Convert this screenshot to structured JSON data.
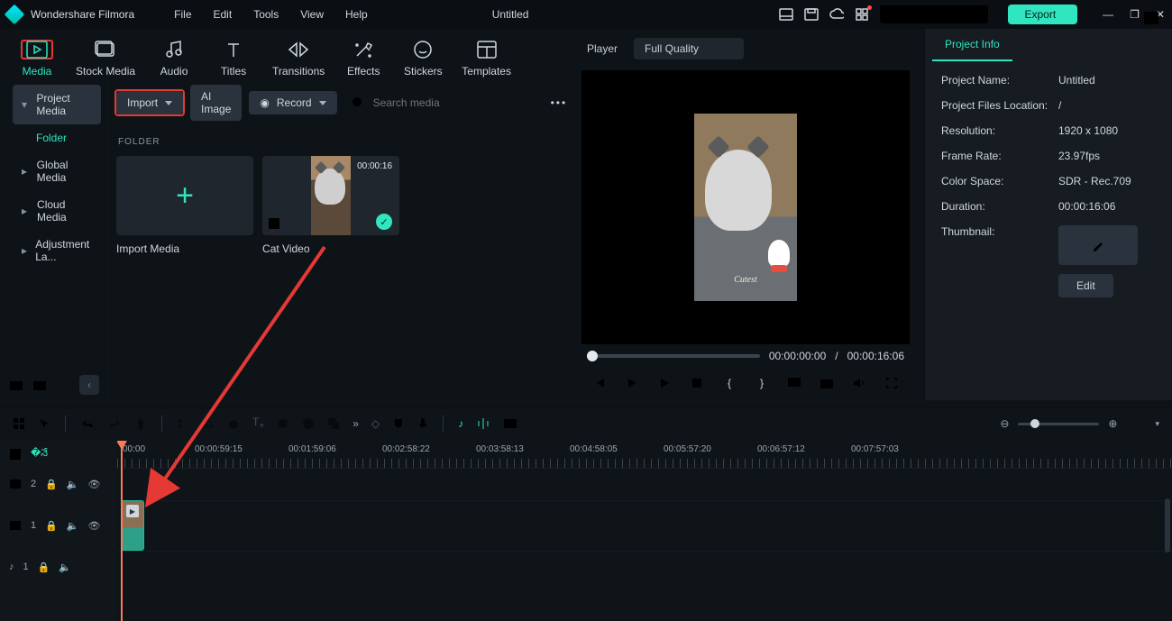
{
  "app": {
    "name": "Wondershare Filmora",
    "doc_title": "Untitled",
    "export": "Export"
  },
  "menu": [
    "File",
    "Edit",
    "Tools",
    "View",
    "Help"
  ],
  "tools": [
    {
      "id": "media",
      "label": "Media"
    },
    {
      "id": "stock-media",
      "label": "Stock Media"
    },
    {
      "id": "audio",
      "label": "Audio"
    },
    {
      "id": "titles",
      "label": "Titles"
    },
    {
      "id": "transitions",
      "label": "Transitions"
    },
    {
      "id": "effects",
      "label": "Effects"
    },
    {
      "id": "stickers",
      "label": "Stickers"
    },
    {
      "id": "templates",
      "label": "Templates"
    }
  ],
  "library": {
    "heading": "Project Media",
    "folder": "Folder",
    "items": [
      "Global Media",
      "Cloud Media",
      "Adjustment La..."
    ]
  },
  "browser": {
    "import": "Import",
    "ai": "AI Image",
    "record": "Record",
    "search_placeholder": "Search media",
    "section": "FOLDER",
    "cards": [
      {
        "label": "Import Media"
      },
      {
        "label": "Cat Video",
        "duration": "00:00:16"
      }
    ]
  },
  "player": {
    "title": "Player",
    "quality": "Full Quality",
    "caption": "Cutest",
    "current": "00:00:00:00",
    "sep": "/",
    "total": "00:00:16:06"
  },
  "info": {
    "tab": "Project Info",
    "rows": {
      "name_k": "Project Name:",
      "name_v": "Untitled",
      "loc_k": "Project Files Location:",
      "loc_v": "/",
      "res_k": "Resolution:",
      "res_v": "1920 x 1080",
      "fps_k": "Frame Rate:",
      "fps_v": "23.97fps",
      "cs_k": "Color Space:",
      "cs_v": "SDR - Rec.709",
      "dur_k": "Duration:",
      "dur_v": "00:00:16:06",
      "thumb_k": "Thumbnail:",
      "edit": "Edit"
    }
  },
  "ruler": [
    "00:00",
    "00:00:59:15",
    "00:01:59:06",
    "00:02:58:22",
    "00:03:58:13",
    "00:04:58:05",
    "00:05:57:20",
    "00:06:57:12",
    "00:07:57:03"
  ],
  "tracks": {
    "v2": "2",
    "v1": "1",
    "a1": "1"
  }
}
